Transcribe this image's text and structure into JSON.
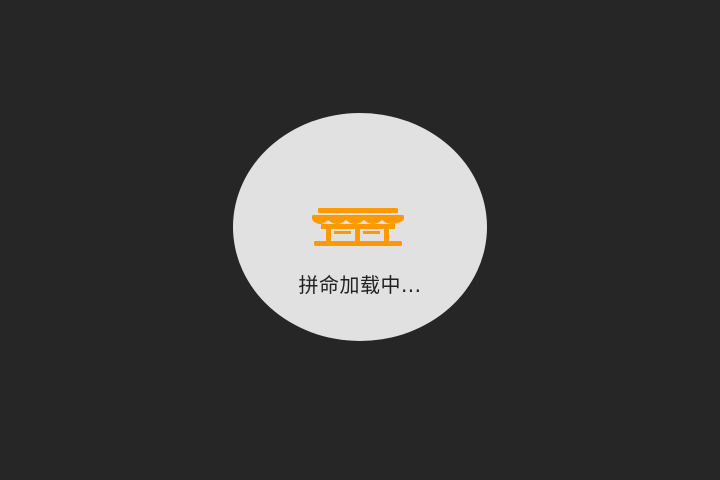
{
  "loader": {
    "message": "拼命加载中...",
    "icon": "storefront-icon",
    "icon_color": "#ff9900",
    "background_color": "#262626",
    "circle_color": "#e1e1e1"
  }
}
